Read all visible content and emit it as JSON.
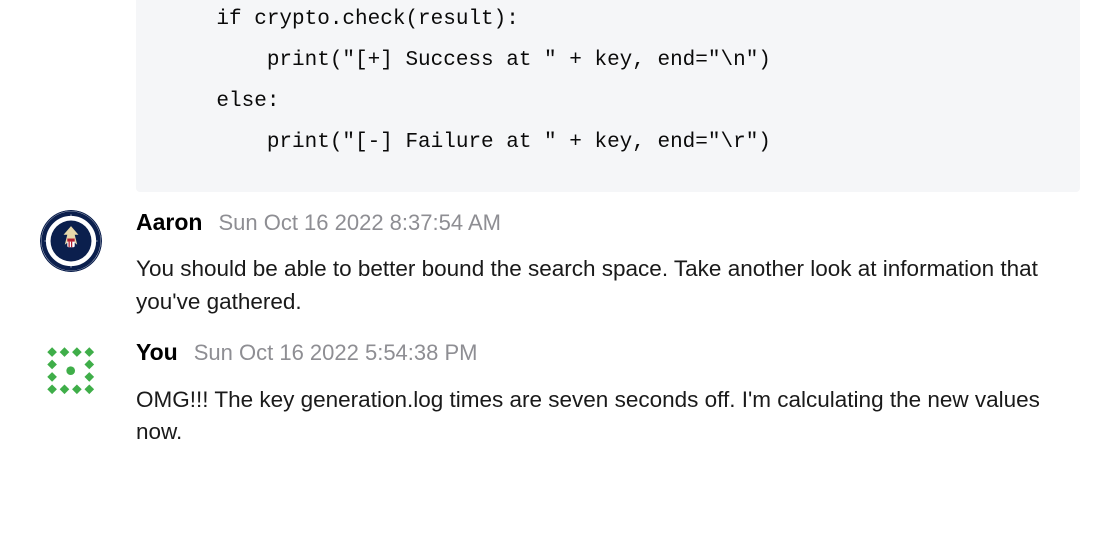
{
  "code_block": {
    "lines": [
      "    if crypto.check(result):",
      "        print(\"[+] Success at \" + key, end=\"\\n\")",
      "    else:",
      "        print(\"[-] Failure at \" + key, end=\"\\r\")"
    ]
  },
  "messages": [
    {
      "author": "Aaron",
      "timestamp": "Sun Oct 16 2022 8:37:54 AM",
      "text": "You should be able to better bound the search space. Take another look at information that you've gathered.",
      "avatar_kind": "nsa-seal"
    },
    {
      "author": "You",
      "timestamp": "Sun Oct 16 2022 5:54:38 PM",
      "text": "OMG!!! The key generation.log times are seven seconds off.  I'm calculating the new values now.",
      "avatar_kind": "identicon"
    }
  ]
}
